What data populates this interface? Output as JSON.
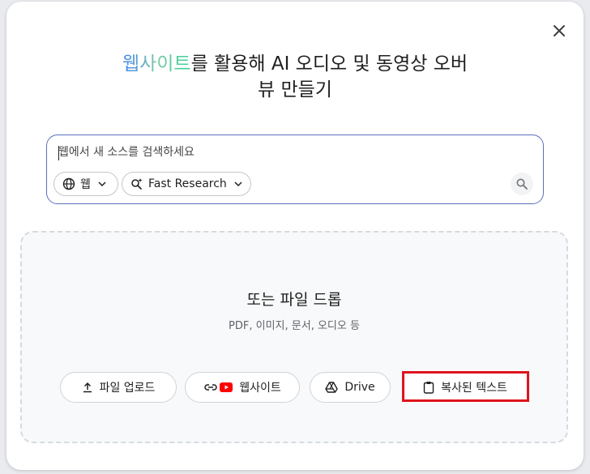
{
  "dialog": {
    "close_icon": "close-icon",
    "title_accent": "웹사이트",
    "title_rest_line1": "를 활용해 AI 오디오 및 동영상 오버",
    "title_line2": "뷰 만들기"
  },
  "search": {
    "placeholder": "웹에서 새 소스를 검색하세요",
    "value": "",
    "source_chip": {
      "label": "웹",
      "icon": "globe-icon"
    },
    "mode_chip": {
      "label": "Fast Research",
      "icon": "search-sparkle-icon"
    },
    "submit_icon": "search-icon"
  },
  "drop_zone": {
    "title": "또는 파일 드롭",
    "subtitle": "PDF, 이미지, 문서, 오디오 등",
    "buttons": [
      {
        "label": "파일 업로드",
        "icon": "upload-icon"
      },
      {
        "label": "웹사이트",
        "icon": "link-youtube-icon"
      },
      {
        "label": "Drive",
        "icon": "drive-icon"
      },
      {
        "label": "복사된 텍스트",
        "icon": "clipboard-icon"
      }
    ]
  },
  "colors": {
    "accent_border": "#5b6fbf",
    "highlight": "#e0141c",
    "youtube_red": "#ff0000"
  }
}
